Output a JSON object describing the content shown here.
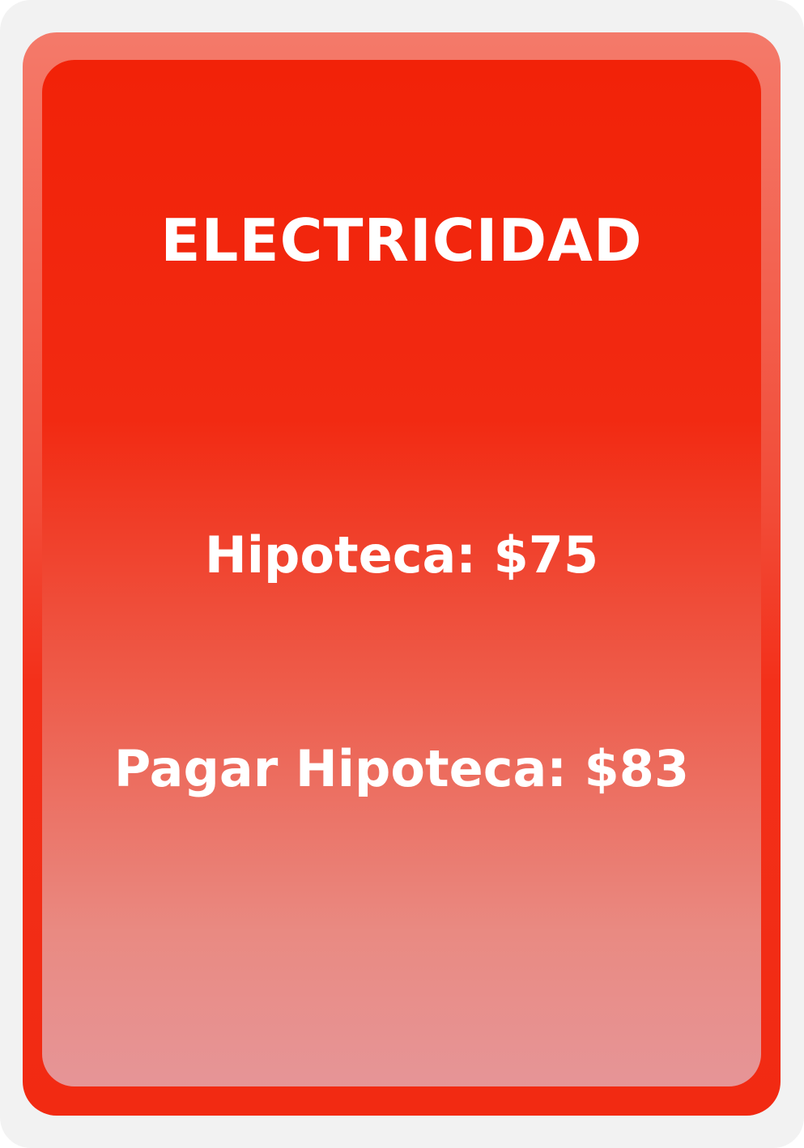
{
  "card": {
    "title": "ELECTRICIDAD",
    "mortgage_label": "Hipoteca: $75",
    "pay_mortgage_label": "Pagar Hipoteca: $83",
    "colors": {
      "frame": "#f2f2f2",
      "border_top": "#f47a6a",
      "border_bottom": "#f22a12",
      "face_top": "#f22208",
      "face_bottom": "#e69597",
      "text": "#ffffff"
    }
  }
}
